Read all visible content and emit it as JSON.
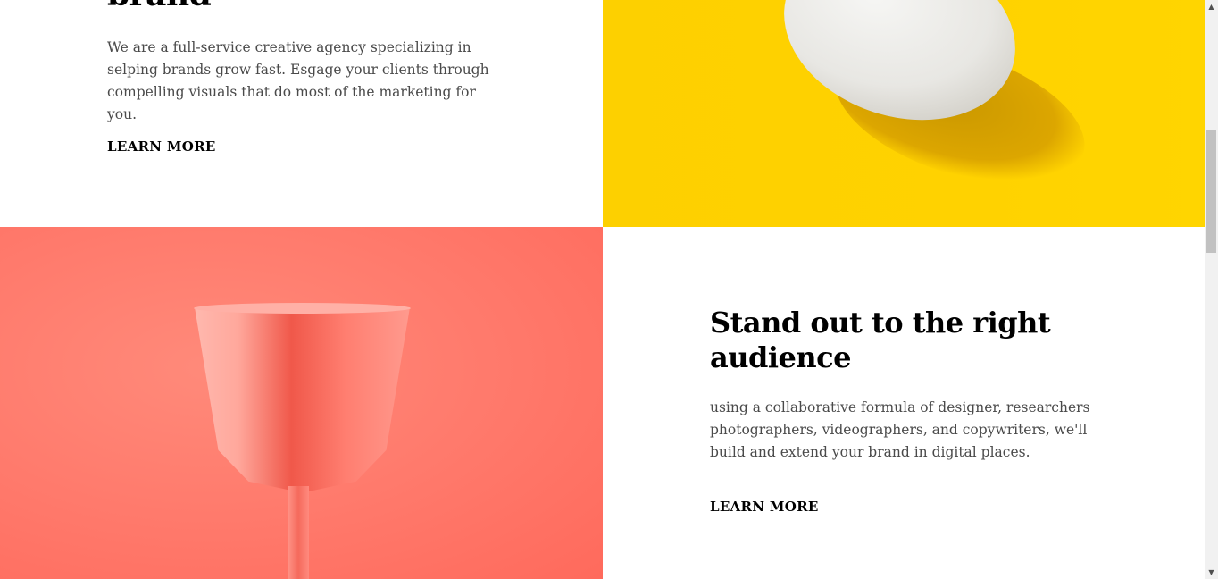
{
  "section_top": {
    "heading_fragment": "brand",
    "body": "We are a full-service creative agency specializing in selping brands grow fast. Esgage your clients through compelling visuals that do most of the marketing for you.",
    "link_label": "LEARN MORE",
    "image": "yellow-egg-photo"
  },
  "section_bottom": {
    "heading": "Stand out to the right audience",
    "body": "using a collaborative formula of designer, researchers photographers, videographers, and copywriters, we'll build and extend your brand in digital places.",
    "link_label": "LEARN MORE",
    "image": "coral-cup-photo"
  },
  "scrollbar": {
    "up_icon": "▲",
    "down_icon": "▼"
  },
  "colors": {
    "heading": "#000000",
    "body_text": "#4a4a4a",
    "yellow_bg": "#ffd200",
    "coral_bg": "#ff7a6c"
  }
}
